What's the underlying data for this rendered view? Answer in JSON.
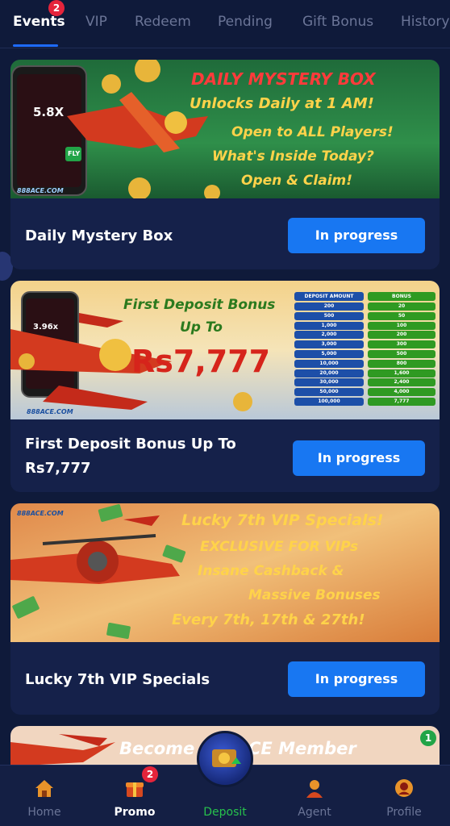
{
  "tabs": [
    {
      "label": "Events",
      "active": true,
      "badge": "2"
    },
    {
      "label": "VIP"
    },
    {
      "label": "Redeem"
    },
    {
      "label": "Pending"
    },
    {
      "label": "Gift Bonus"
    },
    {
      "label": "History"
    }
  ],
  "events": [
    {
      "title": "Daily Mystery Box",
      "status": "In progress",
      "banner": {
        "headline": "DAILY MYSTERY BOX",
        "lines": [
          "Unlocks Daily at 1 AM!",
          "Open to ALL Players!",
          "What's Inside Today?",
          "Open & Claim!"
        ],
        "phone_multiplier": "5.8X",
        "phone_button": "FLY",
        "logo": "888ACE.COM"
      }
    },
    {
      "title": "First Deposit Bonus Up To",
      "subtitle": "Rs7,777",
      "status": "In progress",
      "banner": {
        "headline_1": "First Deposit Bonus",
        "headline_2": "Up To",
        "amount": "Rs7,777",
        "phone_multiplier": "3.96x",
        "logo": "888ACE.COM",
        "table_headers": [
          "DEPOSIT AMOUNT",
          "BONUS"
        ],
        "table_rows": [
          [
            "200",
            "20"
          ],
          [
            "500",
            "50"
          ],
          [
            "1,000",
            "100"
          ],
          [
            "2,000",
            "200"
          ],
          [
            "3,000",
            "300"
          ],
          [
            "5,000",
            "500"
          ],
          [
            "10,000",
            "800"
          ],
          [
            "20,000",
            "1,600"
          ],
          [
            "30,000",
            "2,400"
          ],
          [
            "50,000",
            "4,000"
          ],
          [
            "100,000",
            "7,777"
          ]
        ]
      }
    },
    {
      "title": "Lucky 7th VIP Specials",
      "status": "In progress",
      "banner": {
        "lines": [
          "Lucky 7th VIP Specials!",
          "EXCLUSIVE FOR VIPs",
          "Insane Cashback &",
          "Massive Bonuses",
          "Every 7th, 17th & 27th!"
        ],
        "logo": "888ACE.COM"
      }
    },
    {
      "banner": {
        "headline": "Become 888ACE Member"
      }
    }
  ],
  "floating_badge": "1",
  "bottom_nav": [
    {
      "label": "Home",
      "icon": "home-icon"
    },
    {
      "label": "Promo",
      "icon": "promo-icon",
      "active": true,
      "badge": "2"
    },
    {
      "label": "Deposit",
      "icon": "deposit-icon"
    },
    {
      "label": "Agent",
      "icon": "agent-icon"
    },
    {
      "label": "Profile",
      "icon": "profile-icon"
    }
  ],
  "colors": {
    "background": "#0f1a3a",
    "card": "#15214a",
    "accent_blue": "#1877f2",
    "badge_red": "#e5243b",
    "deposit_green": "#27c24c"
  }
}
